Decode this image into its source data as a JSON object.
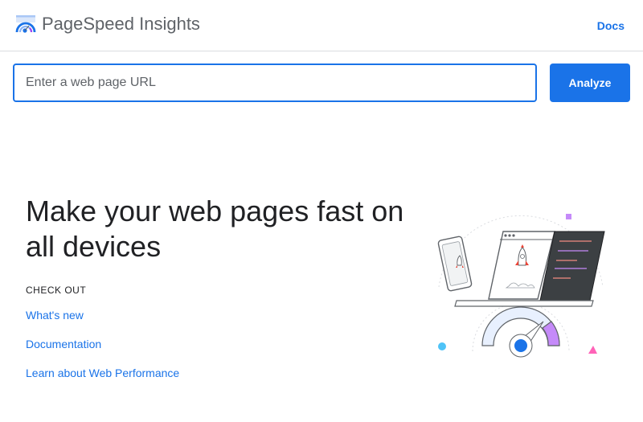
{
  "header": {
    "app_title": "PageSpeed Insights",
    "docs_label": "Docs",
    "logo_icon": "pagespeed-gauge-logo-icon"
  },
  "search": {
    "placeholder": "Enter a web page URL",
    "value": "",
    "analyze_label": "Analyze"
  },
  "hero": {
    "headline": "Make your web pages fast on all devices",
    "check_out_label": "CHECK OUT",
    "links": [
      {
        "label": "What's new"
      },
      {
        "label": "Documentation"
      },
      {
        "label": "Learn about Web Performance"
      }
    ],
    "illustration_icon": "devices-speed-gauge-illustration"
  },
  "colors": {
    "accent": "#1a73e8",
    "title_gray": "#5f6368",
    "text": "#202124",
    "divider": "#dadce0"
  }
}
